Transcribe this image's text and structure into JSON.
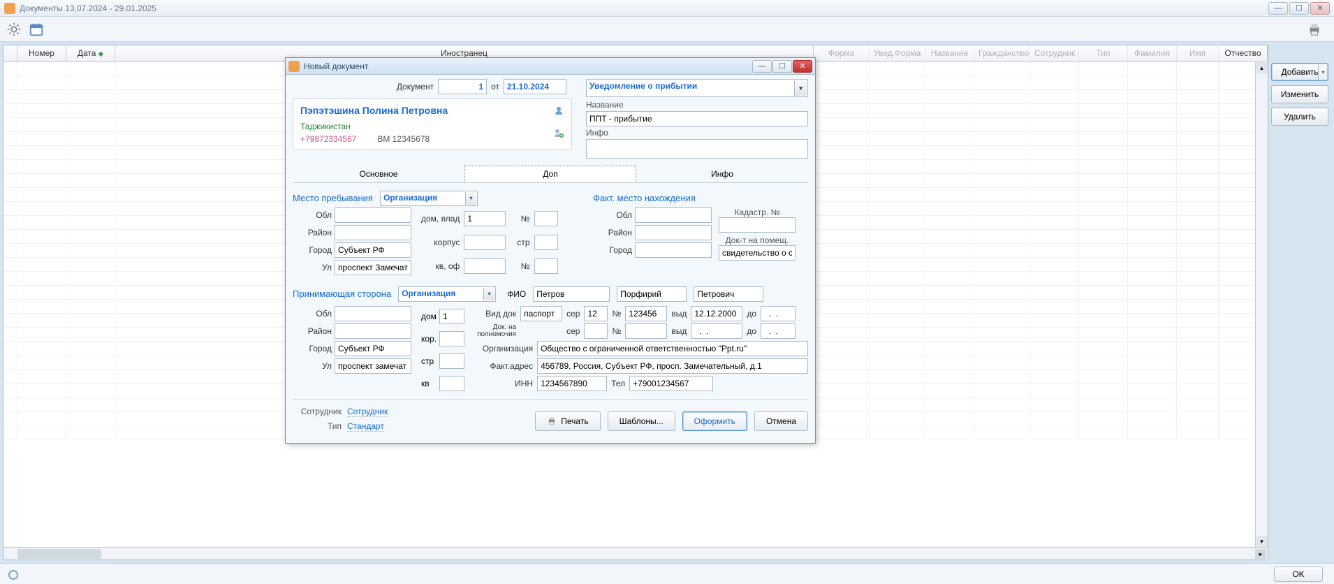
{
  "window": {
    "title": "Документы  13.07.2024  -  29.01.2025"
  },
  "toolbar": {
    "gear": "settings",
    "calendar": "period",
    "printer": "print"
  },
  "grid": {
    "headers": {
      "number": "Номер",
      "date": "Дата",
      "foreigner": "Иностранец",
      "form": "Форма",
      "notif_form": "Увед.Форма",
      "name": "Название",
      "citizenship": "Гражданство",
      "employee": "Сотрудник",
      "type": "Тип",
      "surname": "Фамилия",
      "firstname": "Имя",
      "patronymic": "Отчество"
    }
  },
  "side": {
    "add": "Добавить",
    "edit": "Изменить",
    "delete": "Удалить"
  },
  "bottom": {
    "ok": "OK"
  },
  "modal": {
    "title": "Новый документ",
    "doc_label": "Документ",
    "doc_number": "1",
    "from_label": "от",
    "doc_date": "21.10.2024",
    "notif_type": "Уведомление о прибытии",
    "name_label": "Название",
    "name_value": "ППТ - прибытие",
    "info_label": "Инфо",
    "info_value": "",
    "person": {
      "full_name": "Пэпэтэшина Полина Петровна",
      "country": "Таджикистан",
      "phone": "+79872334567",
      "doc": "ВМ 12345678"
    },
    "tabs": {
      "main": "Основное",
      "extra": "Доп",
      "info": "Инфо",
      "active": "extra"
    },
    "stay": {
      "title": "Место пребывания",
      "type": "Организация",
      "obl_label": "Обл",
      "obl": "",
      "district_label": "Район",
      "district": "",
      "city_label": "Город",
      "city": "Субъект РФ",
      "street_label": "Ул",
      "street": "проспект Замечат",
      "house_label": "дом, влад",
      "house": "1",
      "num_label": "№",
      "num": "",
      "korpus_label": "корпус",
      "korpus": "",
      "str_label": "стр",
      "str": "",
      "kvof_label": "кв, оф",
      "kvof": "",
      "num2_label": "№",
      "num2": ""
    },
    "actual": {
      "title": "Факт. место нахождения",
      "cadastr_label": "Кадастр. №",
      "cadastr": "",
      "obl_label": "Обл",
      "obl": "",
      "district_label": "Район",
      "district": "",
      "city_label": "Город",
      "city": "",
      "premises_label": "Док-т на помещ.",
      "premises": "свидетельство о с"
    },
    "host": {
      "title": "Принимающая сторона",
      "type": "Организация",
      "obl_label": "Обл",
      "obl": "",
      "district_label": "Район",
      "district": "",
      "city_label": "Город",
      "city": "Субъект РФ",
      "street_label": "Ул",
      "street": "проспект замечат",
      "house_label": "дом",
      "house": "1",
      "kor_label": "кор.",
      "kor": "",
      "str_label": "стр",
      "str": "",
      "kv_label": "кв",
      "kv": "",
      "fio_label": "ФИО",
      "surname": "Петров",
      "firstname": "Порфирий",
      "patronymic": "Петрович",
      "doctype_label": "Вид док",
      "doctype": "паспорт",
      "ser_label": "сер",
      "ser": "12",
      "num_label": "№",
      "num": "123456",
      "issued_label": "выд",
      "issued": "12.12.2000",
      "until_label": "до",
      "until": "  .  .",
      "auth_label": "Док. на полномочия",
      "auth_ser_label": "сер",
      "auth_ser": "",
      "auth_num_label": "№",
      "auth_num": "",
      "auth_issued_label": "выд",
      "auth_issued": "  .  .",
      "auth_until_label": "до",
      "auth_until": "  .  .",
      "org_label": "Организация",
      "org": "Общество с ограниченной ответственностью \"Ppt.ru\"",
      "fact_addr_label": "Факт.адрес",
      "fact_addr": "456789, Россия, Субъект РФ, просп. Замечательный, д.1",
      "inn_label": "ИНН",
      "inn": "1234567890",
      "tel_label": "Тел",
      "tel": "+79001234567"
    },
    "footer": {
      "employee_label": "Сотрудник",
      "employee": "Сотрудник",
      "type_label": "Тип",
      "type": "Стандарт",
      "print": "Печать",
      "templates": "Шаблоны...",
      "submit": "Оформить",
      "cancel": "Отмена"
    }
  }
}
